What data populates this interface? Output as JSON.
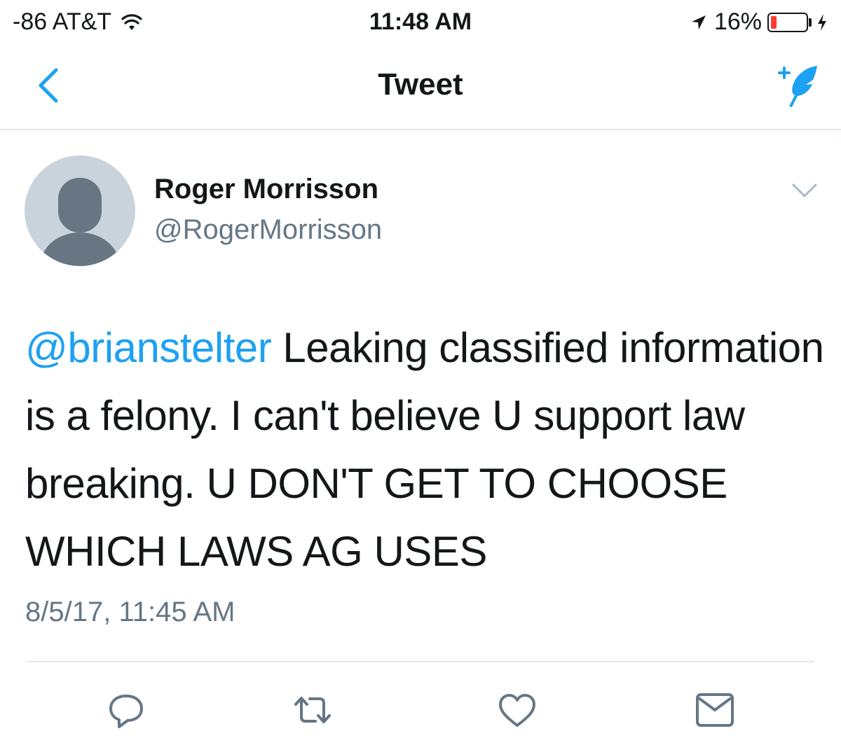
{
  "status_bar": {
    "carrier": "-86 AT&T",
    "time": "11:48 AM",
    "battery": "16%",
    "battery_level": 0.16,
    "battery_color": "#ff3b30",
    "icons": [
      "wifi-icon",
      "location-icon",
      "battery-icon",
      "charging-bolt-icon"
    ]
  },
  "nav": {
    "title": "Tweet",
    "back_icon": "chevron-left-icon",
    "compose_icon": "compose-feather-icon"
  },
  "tweet": {
    "display_name": "Roger Morrisson",
    "handle": "@RogerMorrisson",
    "mention": "@brianstelter",
    "text": " Leaking classified information is a felony. I can't believe U support law breaking. U DON'T GET TO CHOOSE WHICH LAWS AG USES",
    "timestamp": "8/5/17, 11:45 AM"
  },
  "actions": [
    "reply-icon",
    "retweet-icon",
    "like-icon",
    "direct-message-icon"
  ],
  "colors": {
    "accent": "#1da1f2",
    "text": "#14171a",
    "secondary": "#657786",
    "divider": "#e1e8ed",
    "avatar_bg": "#c9d3dc",
    "avatar_figure": "#687684"
  }
}
